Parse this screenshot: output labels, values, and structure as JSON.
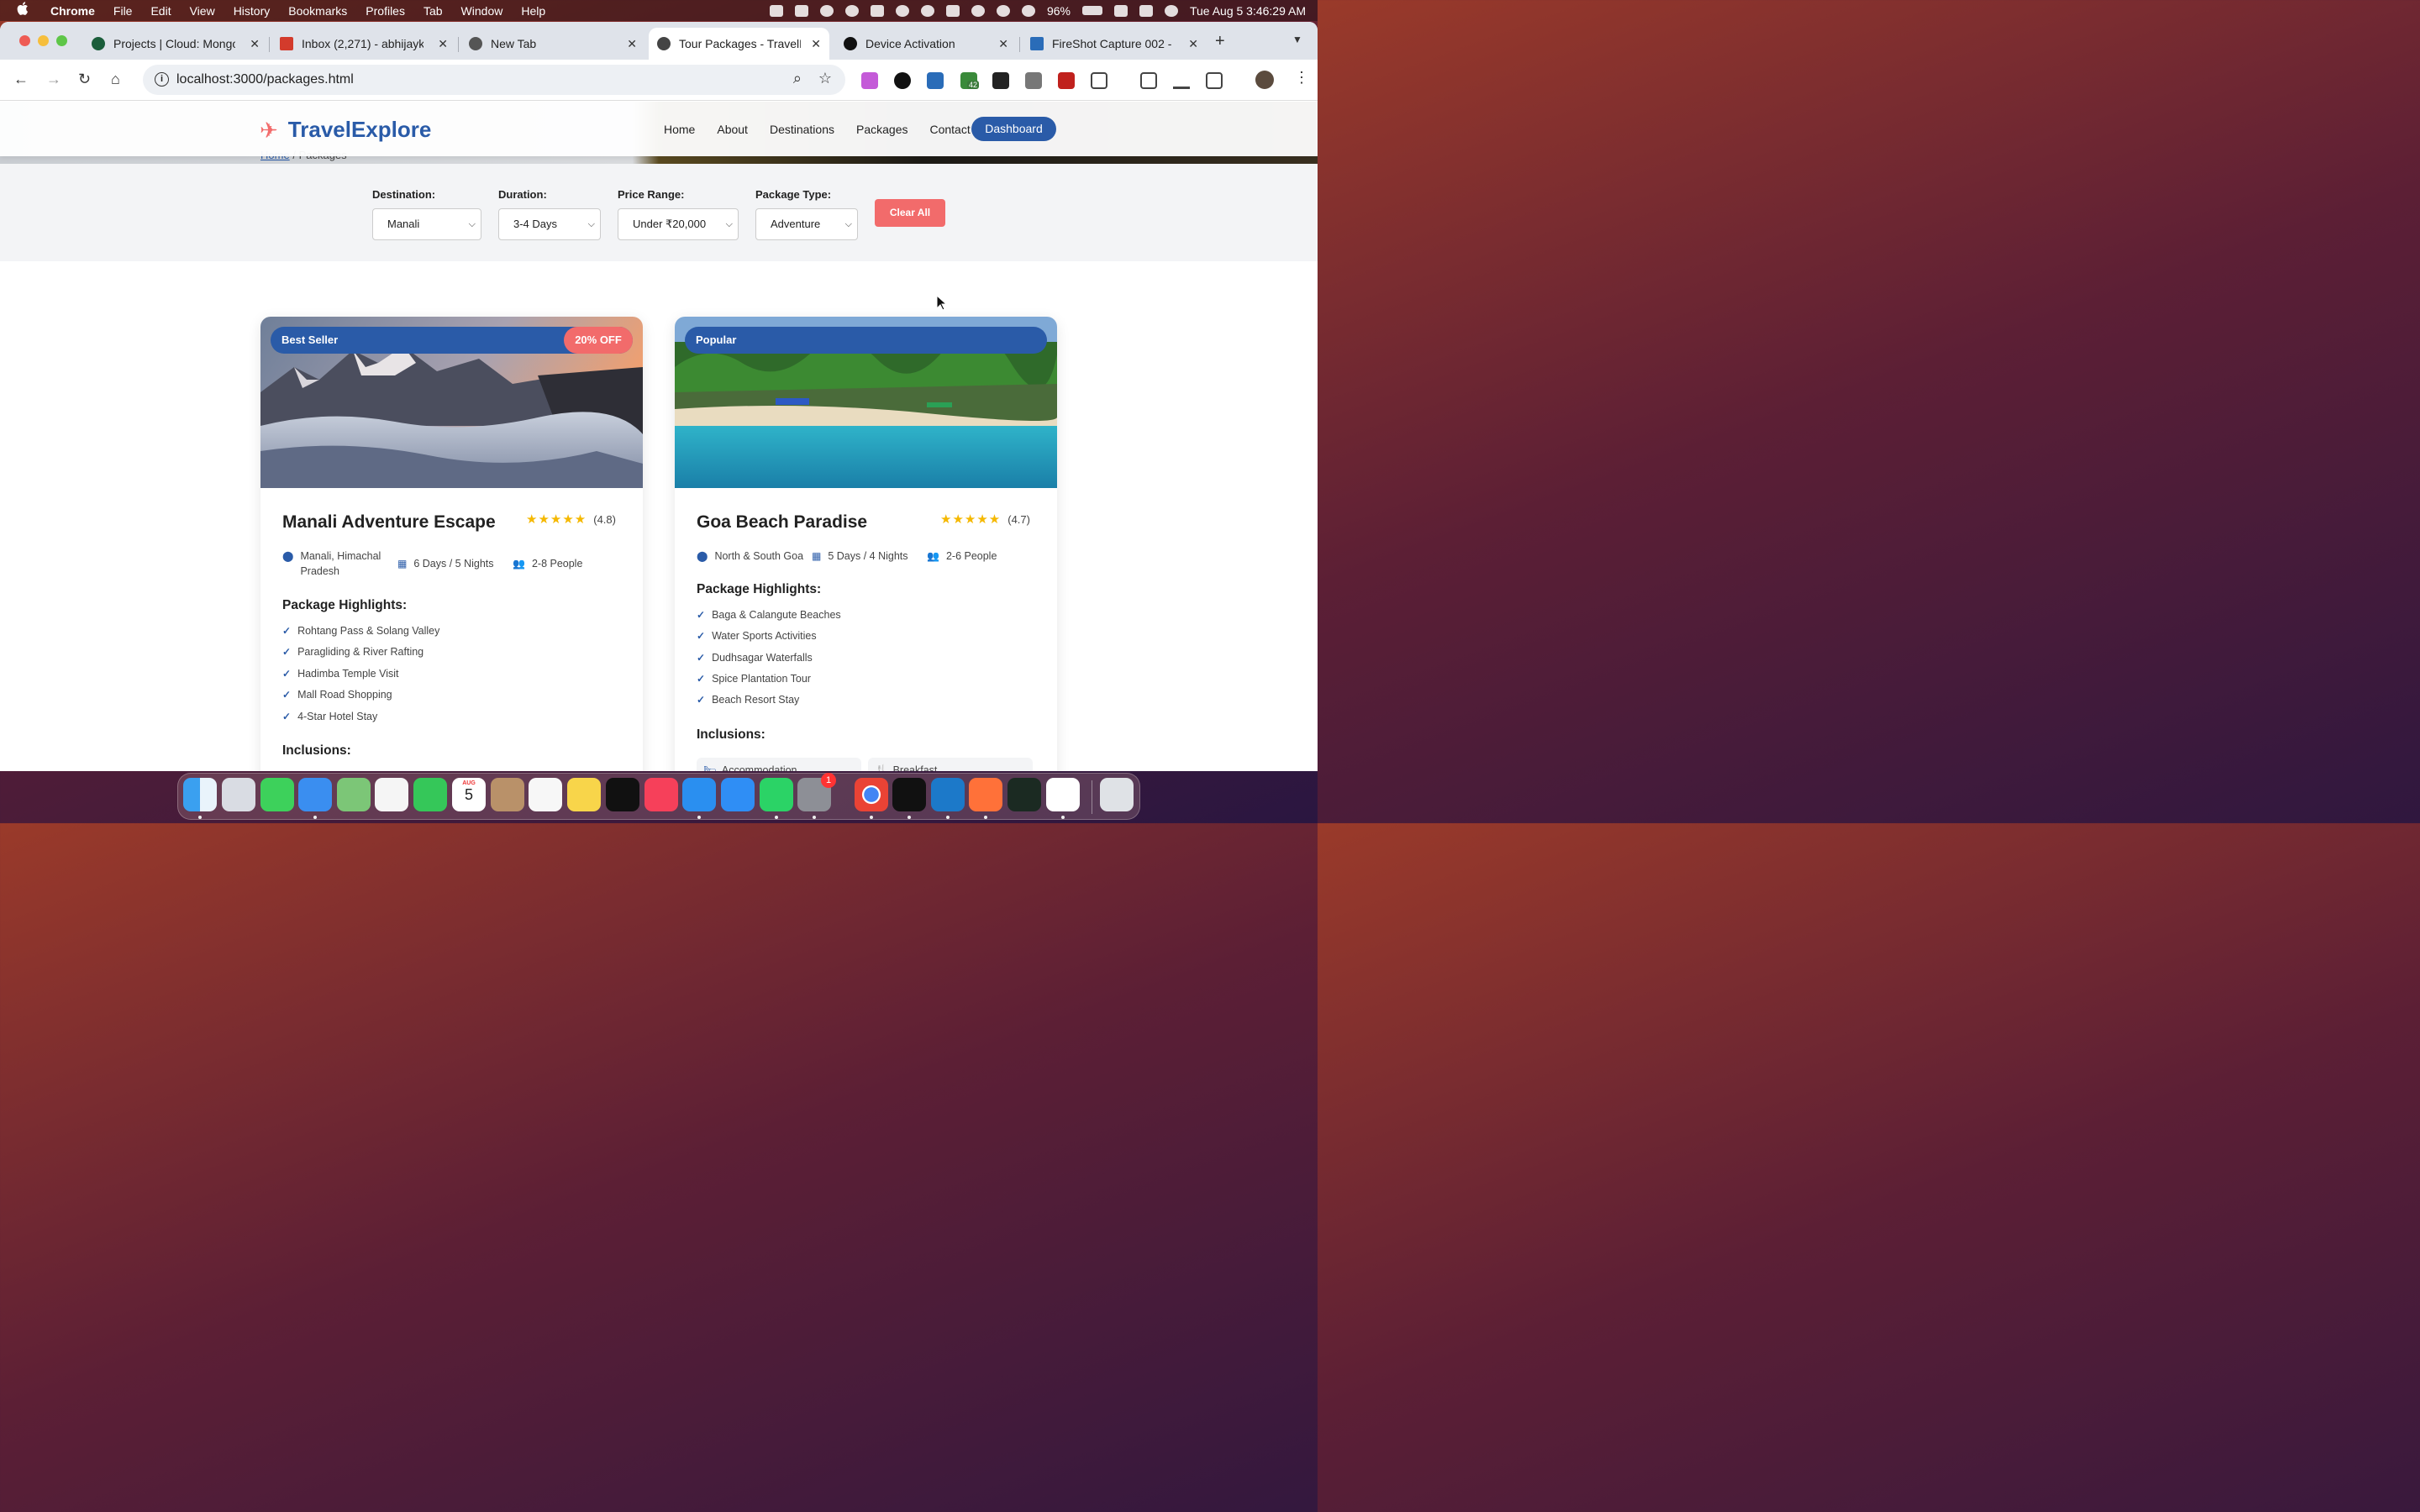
{
  "menubar": {
    "apple": "",
    "items": [
      "Chrome",
      "File",
      "Edit",
      "View",
      "History",
      "Bookmarks",
      "Profiles",
      "Tab",
      "Window",
      "Help"
    ],
    "battery": "96%",
    "datetime": "Tue Aug 5  3:46:29 AM"
  },
  "tabs": [
    {
      "title": "Projects | Cloud: Mongo",
      "color": "#1b5e3b"
    },
    {
      "title": "Inbox (2,271) - abhijayk",
      "color": "#d33b2c"
    },
    {
      "title": "New Tab",
      "color": "#555555"
    },
    {
      "title": "Tour Packages - TravelE",
      "color": "#444444"
    },
    {
      "title": "Device Activation",
      "color": "#111111"
    },
    {
      "title": "FireShot Capture 002 -",
      "color": "#2a6cb8"
    }
  ],
  "toolbar": {
    "url": "localhost:3000/packages.html",
    "extension_badge": "42"
  },
  "site": {
    "brand": "TravelExplore",
    "nav": [
      "Home",
      "About",
      "Destinations",
      "Packages",
      "Contact"
    ],
    "dashboard": "Dashboard",
    "breadcrumb_home": "Home",
    "breadcrumb_sep": "/",
    "breadcrumb_current": "Packages"
  },
  "filters": {
    "destination": {
      "label": "Destination:",
      "value": "Manali"
    },
    "duration": {
      "label": "Duration:",
      "value": "3-4 Days"
    },
    "price": {
      "label": "Price Range:",
      "value": "Under ₹20,000"
    },
    "type": {
      "label": "Package Type:",
      "value": "Adventure"
    },
    "clear": "Clear All"
  },
  "packages": [
    {
      "badge": "Best Seller",
      "discount": "20% OFF",
      "title": "Manali Adventure Escape",
      "stars": "★★★★★",
      "rating": "(4.8)",
      "location": "Manali, Himachal Pradesh",
      "duration": "6 Days / 5 Nights",
      "people": "2-8 People",
      "highlights_title": "Package Highlights:",
      "highlights": [
        "Rohtang Pass & Solang Valley",
        "Paragliding & River Rafting",
        "Hadimba Temple Visit",
        "Mall Road Shopping",
        "4-Star Hotel Stay"
      ],
      "inclusions_title": "Inclusions:"
    },
    {
      "badge": "Popular",
      "title": "Goa Beach Paradise",
      "stars": "★★★★★",
      "rating": "(4.7)",
      "location": "North & South Goa",
      "duration": "5 Days / 4 Nights",
      "people": "2-6 People",
      "highlights_title": "Package Highlights:",
      "highlights": [
        "Baga & Calangute Beaches",
        "Water Sports Activities",
        "Dudhsagar Waterfalls",
        "Spice Plantation Tour",
        "Beach Resort Stay"
      ],
      "inclusions_title": "Inclusions:",
      "inclusions": [
        "Accommodation",
        "Breakfast"
      ]
    }
  ],
  "dock": {
    "calendar_month": "AUG",
    "calendar_day": "5",
    "settings_badge": "1"
  },
  "colors": {
    "brand_blue": "#2a5ba8",
    "accent_coral": "#f26b6b",
    "star_gold": "#f5b800"
  }
}
